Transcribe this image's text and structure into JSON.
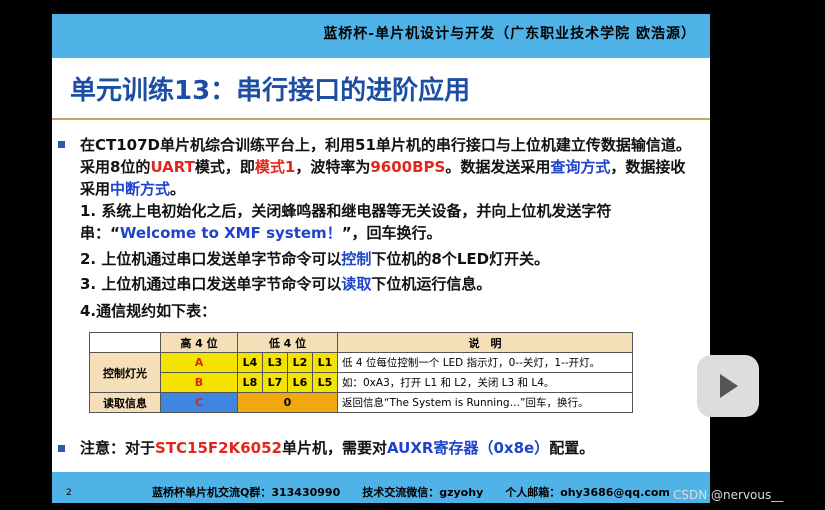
{
  "header": {
    "course": "蓝桥杯-单片机设计与开发（广东职业技术学院 欧浩源）"
  },
  "title": "单元训练13：串行接口的进阶应用",
  "intro": {
    "seg1": "在CT107D单片机综合训练平台上，利用51单片机的串行接口与上位机建立传数据输信道。采用8位的",
    "uart": "UART",
    "seg2": "模式，即",
    "mode": "模式1",
    "seg3": "，波特率为",
    "baud": "9600BPS",
    "seg4": "。数据发送采用",
    "query": "查询方式",
    "seg5": "，数据接收采用",
    "interrupt": "中断方式",
    "seg6": "。"
  },
  "items": {
    "i1_a": "1. 系统上电初始化之后，关闭蜂鸣器和继电器等无关设备，并向上位机发送字符串：“",
    "i1_str": "Welcome to XMF system！",
    "i1_b": "”，回车换行。",
    "i2_a": "2. 上位机通过串口发送单字节命令可以",
    "i2_ctrl": "控制",
    "i2_b": "下位机的8个LED灯开关。",
    "i3_a": "3. 上位机通过串口发送单字节命令可以",
    "i3_read": "读取",
    "i3_b": "下位机运行信息。",
    "i4": "4.通信规约如下表："
  },
  "table": {
    "h_high": "高 4 位",
    "h_low": "低 4 位",
    "h_desc": "说　明",
    "row_ctrl": "控制灯光",
    "a": "A",
    "b": "B",
    "c": "C",
    "l4": "L4",
    "l3": "L3",
    "l2": "L2",
    "l1": "L1",
    "l8": "L8",
    "l7": "L7",
    "l6": "L6",
    "l5": "L5",
    "desc1": "低 4 位每位控制一个 LED 指示灯，0--关灯，1--开灯。",
    "desc2": "如：0xA3，打开 L1 和 L2，关闭 L3 和 L4。",
    "row_read": "读取信息",
    "zero": "0",
    "desc3": "返回信息“The System is Running…”回车，换行。"
  },
  "note": {
    "a": "注意：对于",
    "chip": "STC15F2K6052",
    "b": "单片机，需要对",
    "reg": "AUXR寄存器（0x8e）",
    "c": "配置。"
  },
  "footer": {
    "page": "2",
    "text": "蓝桥杯单片机交流Q群：313430990　　技术交流微信：gzyohy　　个人邮箱：ohy3686@qq.com"
  },
  "watermark": "CSDN @nervous__",
  "colors": {
    "accent": "#4fb3e8",
    "title": "#1c4fa3",
    "red": "#e3261b"
  },
  "icons": {
    "player": "play-icon"
  }
}
